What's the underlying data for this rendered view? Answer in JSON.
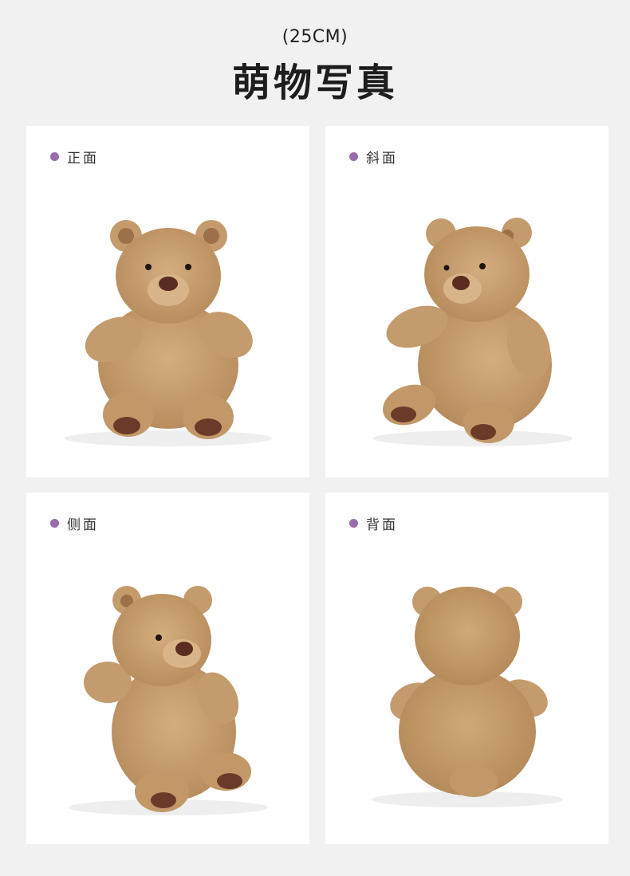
{
  "header": {
    "subtitle": "(25CM)",
    "title": "萌物写真"
  },
  "views": [
    {
      "label": "正面",
      "icon": "teddy-bear-front"
    },
    {
      "label": "斜面",
      "icon": "teddy-bear-angled"
    },
    {
      "label": "侧面",
      "icon": "teddy-bear-side"
    },
    {
      "label": "背面",
      "icon": "teddy-bear-back"
    }
  ],
  "colors": {
    "background": "#f1f1f1",
    "card": "#ffffff",
    "dot": "#9a6bad",
    "fur": "#c49b6c",
    "fur_dark": "#a87c4f",
    "nose": "#5a2d20"
  }
}
